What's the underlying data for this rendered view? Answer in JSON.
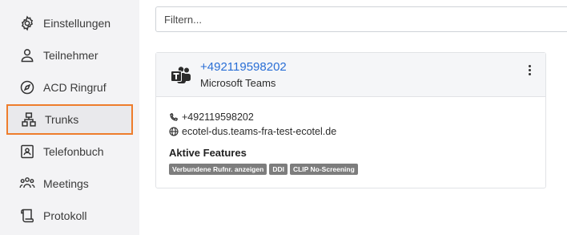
{
  "sidebar": {
    "items": [
      {
        "label": "Einstellungen",
        "icon": "gear-icon"
      },
      {
        "label": "Teilnehmer",
        "icon": "user-icon"
      },
      {
        "label": "ACD Ringruf",
        "icon": "compass-icon"
      },
      {
        "label": "Trunks",
        "icon": "network-icon",
        "active": true
      },
      {
        "label": "Telefonbuch",
        "icon": "contact-book-icon"
      },
      {
        "label": "Meetings",
        "icon": "group-icon"
      },
      {
        "label": "Protokoll",
        "icon": "scroll-icon"
      }
    ]
  },
  "filter": {
    "placeholder": "Filtern...",
    "value": ""
  },
  "trunk": {
    "number": "+492119598202",
    "type": "Microsoft Teams",
    "phone": "+492119598202",
    "domain": "ecotel-dus.teams-fra-test-ecotel.de",
    "features_title": "Aktive Features",
    "features": [
      "Verbundene Rufnr. anzeigen",
      "DDI",
      "CLIP No-Screening"
    ]
  },
  "colors": {
    "accent_link": "#2a6fd6",
    "active_outline": "#ee7d2c",
    "badge": "#7d7d7d",
    "sidebar_bg": "#f3f3f5"
  }
}
